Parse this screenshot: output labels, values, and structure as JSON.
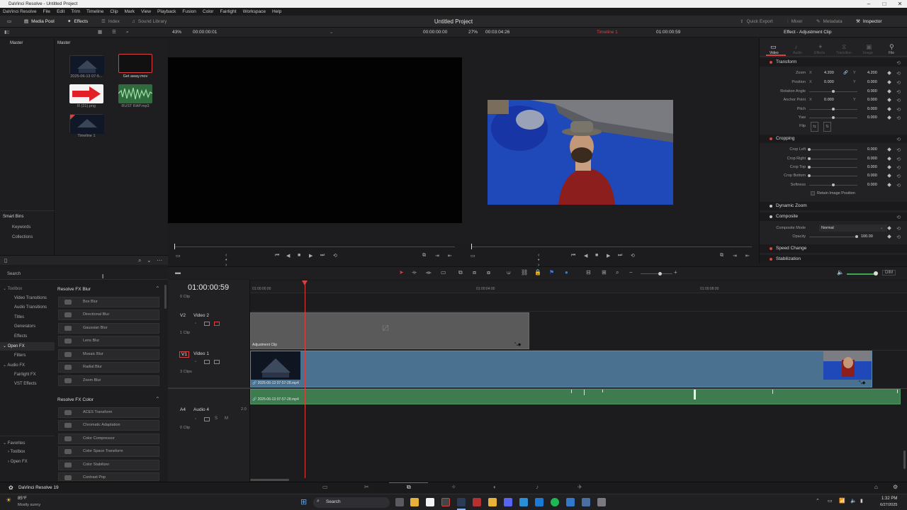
{
  "app": {
    "window_title": "DaVinci Resolve - Untitled Project",
    "project_title": "Untitled Project",
    "menu": [
      "DaVinci Resolve",
      "File",
      "Edit",
      "Trim",
      "Timeline",
      "Clip",
      "Mark",
      "View",
      "Playback",
      "Fusion",
      "Color",
      "Fairlight",
      "Workspace",
      "Help"
    ]
  },
  "toolbar": {
    "media_pool": "Media Pool",
    "effects": "Effects",
    "index": "Index",
    "sound_library": "Sound Library",
    "quick_export": "Quick Export",
    "mixer": "Mixer",
    "metadata": "Metadata",
    "inspector": "Inspector"
  },
  "subheader": {
    "source_zoom": "43%",
    "source_tc": "00:00:00:01",
    "program_tc_left": "00:00:00:00",
    "program_zoom": "27%",
    "program_duration": "00:03:04:26",
    "timeline_name": "Timeline 1",
    "program_tc_right": "01:00:00:59",
    "inspector_title": "Effect - Adjustment Clip"
  },
  "media_pool": {
    "bin_header": "Master",
    "content_header": "Master",
    "smart_bins": "Smart Bins",
    "keywords": "Keywords",
    "collections": "Collections",
    "clips": [
      {
        "name": "2025-06-13 07-5...",
        "kind": "video"
      },
      {
        "name": "Get away.mov",
        "kind": "black"
      },
      {
        "name": "R (21).png",
        "kind": "arrow"
      },
      {
        "name": "RUST RAP.mp3",
        "kind": "audio"
      },
      {
        "name": "Timeline 1",
        "kind": "timeline"
      }
    ]
  },
  "inspector": {
    "tabs": [
      "Video",
      "Audio",
      "Effects",
      "Transition",
      "Image",
      "File"
    ],
    "transform": {
      "title": "Transform",
      "zoom_label": "Zoom",
      "zoom_x": "4.200",
      "zoom_y": "4.200",
      "position_label": "Position",
      "position_x": "0.000",
      "position_y": "0.000",
      "rotation_label": "Rotation Angle",
      "rotation": "0.000",
      "anchor_label": "Anchor Point",
      "anchor_x": "0.000",
      "anchor_y": "0.000",
      "pitch_label": "Pitch",
      "pitch": "0.000",
      "yaw_label": "Yaw",
      "yaw": "0.000",
      "flip_label": "Flip"
    },
    "cropping": {
      "title": "Cropping",
      "crop_left_label": "Crop Left",
      "crop_left": "0.000",
      "crop_right_label": "Crop Right",
      "crop_right": "0.000",
      "crop_top_label": "Crop Top",
      "crop_top": "0.000",
      "crop_bottom_label": "Crop Bottom",
      "crop_bottom": "0.000",
      "softness_label": "Softness",
      "softness": "0.000",
      "retain_label": "Retain Image Position"
    },
    "dynamic_zoom": "Dynamic Zoom",
    "composite": {
      "title": "Composite",
      "mode_label": "Composite Mode",
      "mode": "Normal",
      "opacity_label": "Opacity",
      "opacity": "100.00"
    },
    "speed_change": "Speed Change",
    "stabilization": "Stabilization"
  },
  "effects": {
    "search_placeholder": "Search",
    "tree": [
      "Toolbox",
      "Video Transitions",
      "Audio Transitions",
      "Titles",
      "Generators",
      "Effects",
      "Open FX",
      "Filters",
      "Audio FX",
      "Fairlight FX",
      "VST Effects",
      "Favorites",
      "Toolbox",
      "Open FX"
    ],
    "category1": "Resolve FX Blur",
    "blur_items": [
      "Box Blur",
      "Directional Blur",
      "Gaussian Blur",
      "Lens Blur",
      "Mosaic Blur",
      "Radial Blur",
      "Zoom Blur"
    ],
    "category2": "Resolve FX Color",
    "color_items": [
      "ACES Transform",
      "Chromatic Adaptation",
      "Color Compressor",
      "Color Space Transform",
      "Color Stabilizer",
      "Contrast Pop"
    ]
  },
  "timeline": {
    "timecode": "01:00:00:59",
    "ruler": [
      "01:00:00:00",
      "01:00:04:00",
      "01:00:08:00"
    ],
    "tracks": {
      "v2_id": "V2",
      "v2_name": "Video 2",
      "v2_clips": "1 Clip",
      "v1_id": "V1",
      "v1_name": "Video 1",
      "v1_clips": "3 Clips",
      "a4_id": "A4",
      "a4_name": "Audio 4",
      "a4_level": "2.0",
      "a4_clips": "0 Clip",
      "top_clips": "0 Clip"
    },
    "adjustment_clip": "Adjustment Clip",
    "video_clip": "2025-06-13 07-57-28.mp4",
    "audio_clip": "2025-06-13 07-57-28.mp4",
    "dim": "DIM"
  },
  "pagebar": {
    "app_name": "DaVinci Resolve 19"
  },
  "taskbar": {
    "weather_temp": "85°F",
    "weather_desc": "Mostly sunny",
    "search": "Search",
    "time": "1:32 PM",
    "date": "6/27/2025"
  },
  "colors": {
    "accent_red": "#d94040",
    "video_clip": "#4b7190",
    "audio_clip": "#3e7c4f",
    "adjustment_clip": "#5a5a5a"
  }
}
